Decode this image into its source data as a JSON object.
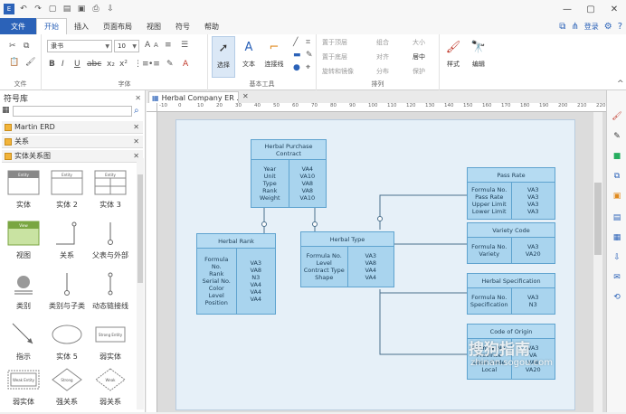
{
  "title_bar": {
    "quick_icons": [
      "undo-icon",
      "redo-icon",
      "new-icon",
      "open-icon",
      "save-icon",
      "print-icon",
      "export-icon"
    ]
  },
  "tabs": [
    {
      "label": "文件"
    },
    {
      "label": "开始"
    },
    {
      "label": "插入"
    },
    {
      "label": "页面布局"
    },
    {
      "label": "视图"
    },
    {
      "label": "符号"
    },
    {
      "label": "帮助"
    }
  ],
  "account": {
    "login_label": "登录"
  },
  "ribbon": {
    "font_name": "隶书",
    "font_size": "10",
    "groups": {
      "file_label": "文件",
      "font_label": "字体",
      "basic_tools_label": "基本工具",
      "arrange_label": "排列"
    },
    "select_label": "选择",
    "text_label": "文本",
    "connector_label": "连接线",
    "style_label": "样式",
    "edit_label": "编辑",
    "arrange_items": [
      "置于顶层",
      "组合",
      "大小",
      "置于底层",
      "对齐",
      "居中",
      "旋转和镜像",
      "分布",
      "保护"
    ]
  },
  "left_panel": {
    "title": "符号库",
    "libraries": [
      {
        "name": "Martin ERD"
      },
      {
        "name": "关系"
      },
      {
        "name": "实体关系图"
      }
    ],
    "shapes": [
      {
        "label": "实体"
      },
      {
        "label": "实体 2"
      },
      {
        "label": "实体 3"
      },
      {
        "label": "视图"
      },
      {
        "label": "关系"
      },
      {
        "label": "父表与外部"
      },
      {
        "label": "类别"
      },
      {
        "label": "类别与子类"
      },
      {
        "label": "动态链接线"
      },
      {
        "label": "指示"
      },
      {
        "label": "实体 5"
      },
      {
        "label": "弱实体"
      },
      {
        "label": "弱实体"
      },
      {
        "label": "强关系"
      },
      {
        "label": "弱关系"
      }
    ],
    "shape_mini_text": {
      "entity_header": "Entity",
      "view_header": "View",
      "strong_entity": "Strong Entity",
      "weak_entity": "Weak Entity",
      "strong_rel": "Strong",
      "weak_rel": "Weak"
    }
  },
  "document": {
    "tab_title": "Herbal Company ER ..."
  },
  "ruler": {
    "h_ticks": [
      "-10",
      "0",
      "10",
      "20",
      "30",
      "40",
      "50",
      "60",
      "70",
      "80",
      "90",
      "100",
      "110",
      "120",
      "130",
      "140",
      "150",
      "160",
      "170",
      "180",
      "190",
      "200",
      "210",
      "220"
    ]
  },
  "entities": {
    "purchase": {
      "title": "Herbal Purchase Contract",
      "left": [
        "Year",
        "Unit",
        "Type",
        "Rank",
        "Weight"
      ],
      "right": [
        "VA4",
        "VA10",
        "VA8",
        "VA8",
        "VA10"
      ]
    },
    "rank": {
      "title": "Herbal Rank",
      "left": [
        "Formula",
        "No.",
        "Rank",
        "Serial No.",
        "Color",
        "Level",
        "Position"
      ],
      "right": [
        "VA3",
        "VA8",
        "N3",
        "VA4",
        "VA4",
        "VA4"
      ]
    },
    "type": {
      "title": "Herbal Type",
      "left": [
        "Formula No.",
        "Level",
        "Contract Type",
        "Shape"
      ],
      "right": [
        "VA3",
        "VA8",
        "VA4",
        "VA4"
      ]
    },
    "pass_rate": {
      "title": "Pass Rate",
      "left": [
        "Formula No.",
        "Pass Rate",
        "Upper Limit",
        "Lower Limit"
      ],
      "right": [
        "VA3",
        "VA3",
        "VA3",
        "VA3"
      ]
    },
    "variety": {
      "title": "Variety Code",
      "left": [
        "Formula No.",
        "Variety"
      ],
      "right": [
        "VA3",
        "VA20"
      ]
    },
    "spec": {
      "title": "Herbal Specification",
      "left": [
        "Formula No.",
        "Specification"
      ],
      "right": [
        "VA3",
        "N3"
      ]
    },
    "origin": {
      "title": "Code of Origin",
      "left": [
        "Formula No.",
        "Province",
        "Local Code",
        "Local"
      ],
      "right": [
        "VA3",
        "VA",
        "VA8",
        "VA20"
      ]
    }
  },
  "watermark": {
    "main": "搜狗指南",
    "sub": "zhinan.sogou.com"
  }
}
